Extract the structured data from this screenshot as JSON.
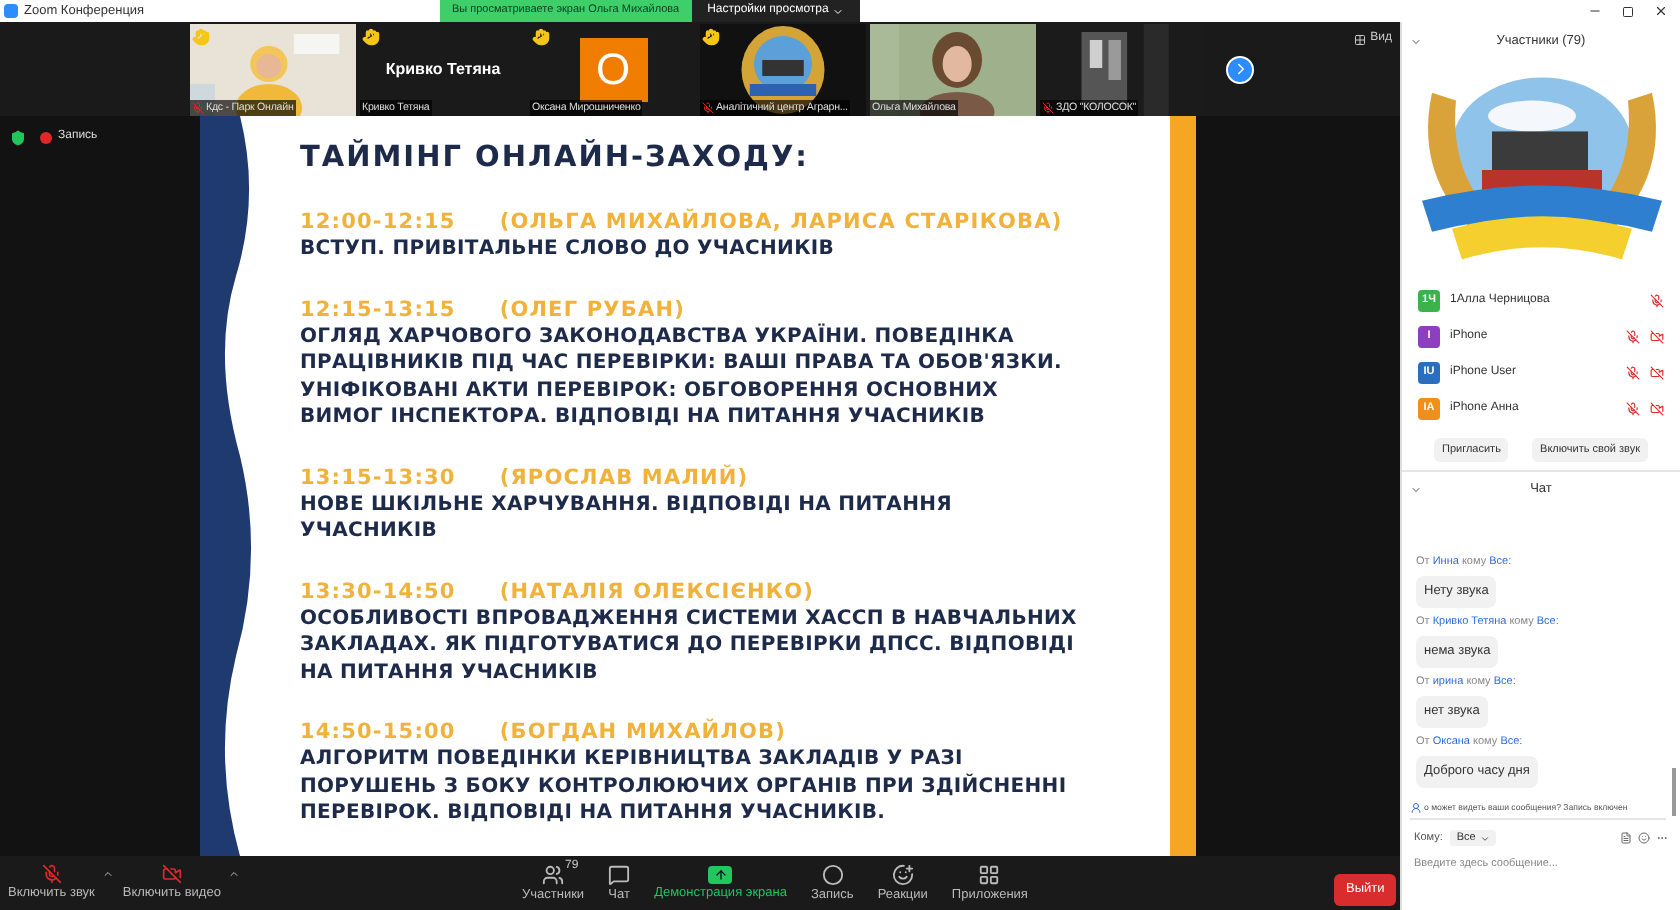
{
  "window": {
    "title": "Zoom Конференция",
    "banner": "Вы просматриваете экран Ольга Михайлова",
    "view_settings": "Настройки просмотра"
  },
  "video_strip": {
    "tiles": [
      {
        "kind": "picture",
        "label": "Кдс - Парк Онлайн",
        "muted": true,
        "hand_raised": true
      },
      {
        "kind": "name",
        "name": "Кривко Тетяна",
        "label": "Кривко Тетяна",
        "muted": false,
        "hand_raised": true
      },
      {
        "kind": "avatar",
        "initial": "O",
        "label": "Оксана Мирошниченко",
        "muted": false,
        "hand_raised": true
      },
      {
        "kind": "picture",
        "label": "Аналітичний центр Аграрн...",
        "muted": true,
        "hand_raised": true
      },
      {
        "kind": "picture",
        "label": "Ольга Михайлова",
        "muted": false,
        "hand_raised": false
      },
      {
        "kind": "picture",
        "label": "ЗДО \"КОЛОСОК\"",
        "muted": true,
        "hand_raised": false
      }
    ],
    "view": "Вид"
  },
  "recording": {
    "label": "Запись"
  },
  "slide": {
    "title": "ТАЙМІНГ ОНЛАЙН-ЗАХОДУ:",
    "items": [
      {
        "time": "12:00-12:15",
        "speaker": "(ОЛЬГА МИХАЙЛОВА, ЛАРИСА СТАРІКОВА)",
        "text": "ВСТУП. ПРИВІТАЛЬНЕ СЛОВО ДО УЧАСНИКІВ"
      },
      {
        "time": "12:15-13:15",
        "speaker": "(ОЛЕГ РУБАН)",
        "text": "ОГЛЯД ХАРЧОВОГО ЗАКОНОДАВСТВА УКРАЇНИ. ПОВЕДІНКА ПРАЦІВНИКІВ ПІД ЧАС ПЕРЕВІРКИ: ВАШІ ПРАВА ТА ОБОВ'ЯЗКИ. УНІФІКОВАНІ АКТИ ПЕРЕВІРОК: ОБГОВОРЕННЯ ОСНОВНИХ ВИМОГ ІНСПЕКТОРА. ВІДПОВІДІ НА ПИТАННЯ УЧАСНИКІВ"
      },
      {
        "time": "13:15-13:30",
        "speaker": "(ЯРОСЛАВ МАЛИЙ)",
        "text": "НОВЕ ШКІЛЬНЕ ХАРЧУВАННЯ. ВІДПОВІДІ НА ПИТАННЯ УЧАСНИКІВ"
      },
      {
        "time": "13:30-14:50",
        "speaker": "(НАТАЛІЯ ОЛЕКСІЄНКО)",
        "text": "ОСОБЛИВОСТІ ВПРОВАДЖЕННЯ СИСТЕМИ ХАССП В НАВЧАЛЬНИХ ЗАКЛАДАХ. ЯК ПІДГОТУВАТИСЯ ДО ПЕРЕВІРКИ ДПСС. ВІДПОВІДІ НА ПИТАННЯ УЧАСНИКІВ"
      },
      {
        "time": "14:50-15:00",
        "speaker": "(БОГДАН МИХАЙЛОВ)",
        "text": "АЛГОРИТМ ПОВЕДІНКИ КЕРІВНИЦТВА ЗАКЛАДІВ У РАЗІ ПОРУШЕНЬ З БОКУ КОНТРОЛЮЮЧИХ ОРГАНІВ ПРИ ЗДІЙСНЕННІ ПЕРЕВІРОК. ВІДПОВІДІ НА ПИТАННЯ УЧАСНИКІВ."
      }
    ]
  },
  "participants": {
    "title": "Участники (79)",
    "items": [
      {
        "initials": "1Ч",
        "name": "1Алла Черницова",
        "color": "#3bb34a",
        "muted": true,
        "video_off": false
      },
      {
        "initials": "I",
        "name": "iPhone",
        "color": "#8e3fbf",
        "muted": true,
        "video_off": true
      },
      {
        "initials": "IU",
        "name": "iPhone User",
        "color": "#2a6fbf",
        "muted": true,
        "video_off": true
      },
      {
        "initials": "IA",
        "name": "iPhone Анна",
        "color": "#f0901a",
        "muted": true,
        "video_off": true
      }
    ],
    "buttons": [
      "Пригласить",
      "Включить свой звук"
    ]
  },
  "chat": {
    "title": "Чат",
    "messages": [
      {
        "from_label": "От",
        "sender": "Инна",
        "to_label": "кому",
        "recipient": "Все:",
        "text": "Нету звука"
      },
      {
        "from_label": "От",
        "sender": "Кривко Тетяна",
        "to_label": "кому",
        "recipient": "Все:",
        "text": "нема звука"
      },
      {
        "from_label": "От",
        "sender": "ирина",
        "to_label": "кому",
        "recipient": "Все:",
        "text": "нет звука"
      },
      {
        "from_label": "От",
        "sender": "Оксана",
        "to_label": "кому",
        "recipient": "Все:",
        "text": "Доброго часу дня"
      }
    ],
    "notice": "о может видеть ваши сообщения? Запись включен",
    "to_label": "Кому:",
    "to_value": "Все",
    "placeholder": "Введите здесь сообщение..."
  },
  "toolbar": {
    "left": [
      {
        "kind": "mic",
        "label": "Включить звук"
      },
      {
        "kind": "video",
        "label": "Включить видео"
      }
    ],
    "center": [
      {
        "kind": "participants",
        "label": "Участники",
        "badge": "79",
        "selected": false
      },
      {
        "kind": "chat",
        "label": "Чат",
        "selected": false
      },
      {
        "kind": "share",
        "label": "Демонстрация экрана",
        "selected": true
      },
      {
        "kind": "record",
        "label": "Запись",
        "selected": false
      },
      {
        "kind": "reactions",
        "label": "Реакции",
        "selected": false
      },
      {
        "kind": "apps",
        "label": "Приложения",
        "selected": false
      }
    ],
    "leave": "Выйти"
  }
}
